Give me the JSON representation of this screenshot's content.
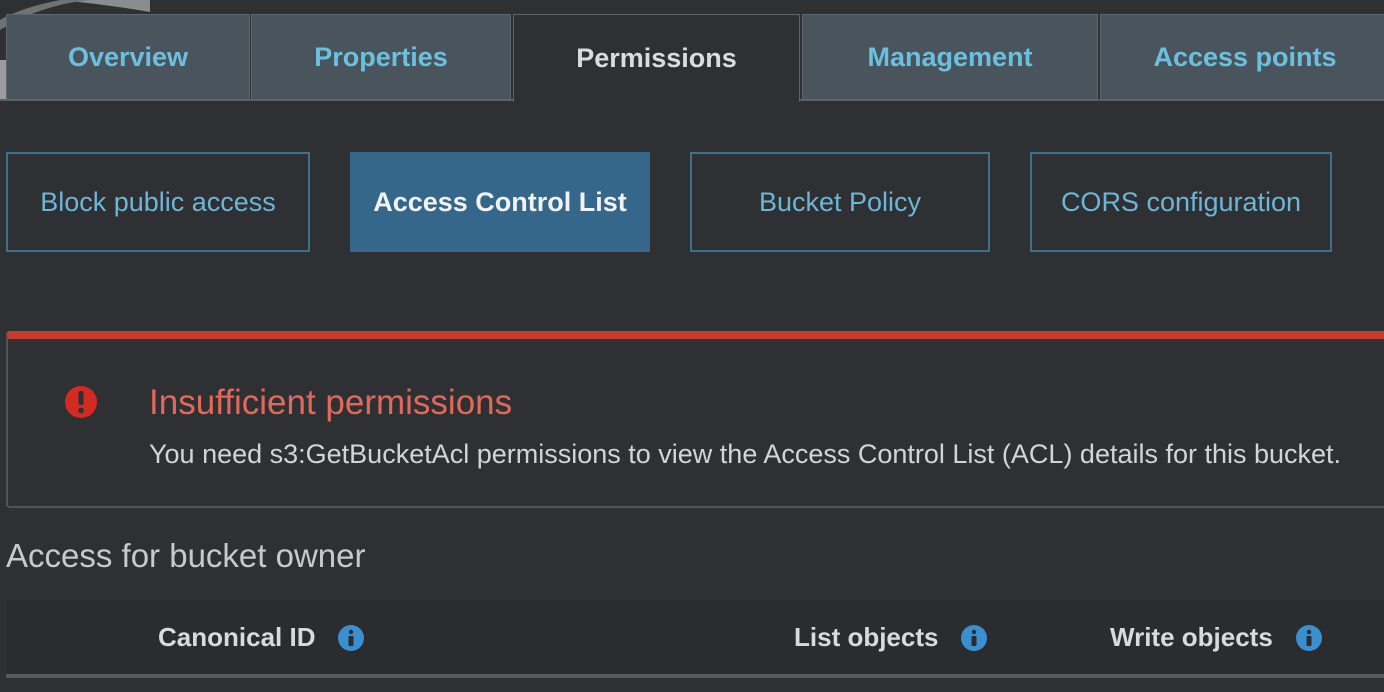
{
  "tabs": [
    {
      "label": "Overview",
      "active": false
    },
    {
      "label": "Properties",
      "active": false
    },
    {
      "label": "Permissions",
      "active": true
    },
    {
      "label": "Management",
      "active": false
    },
    {
      "label": "Access points",
      "active": false
    }
  ],
  "subtabs": [
    {
      "label": "Block public access",
      "active": false
    },
    {
      "label": "Access Control List",
      "active": true
    },
    {
      "label": "Bucket Policy",
      "active": false
    },
    {
      "label": "CORS configuration",
      "active": false
    }
  ],
  "alert": {
    "icon": "error-icon",
    "title": "Insufficient permissions",
    "message": "You need s3:GetBucketAcl permissions to view the Access Control List (ACL) details for this bucket."
  },
  "section": {
    "heading": "Access for bucket owner",
    "columns": [
      {
        "label": "Canonical ID",
        "icon": "info-icon"
      },
      {
        "label": "List objects",
        "icon": "info-icon"
      },
      {
        "label": "Write objects",
        "icon": "info-icon"
      }
    ]
  },
  "colors": {
    "accent": "#6cc0df",
    "active_subtab": "#346789",
    "error": "#c93a2e",
    "info": "#3a8fd0"
  }
}
